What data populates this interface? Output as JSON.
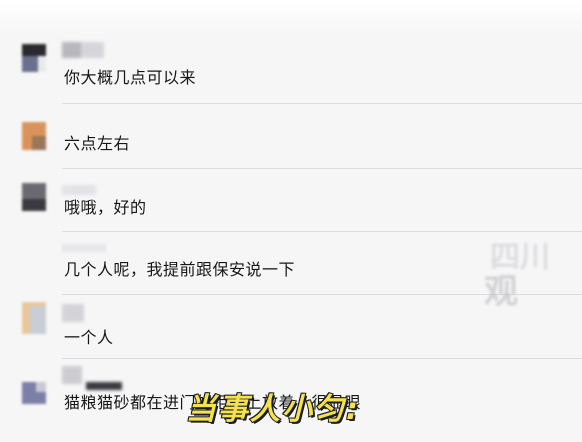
{
  "chat": {
    "messages": [
      {
        "text": "你大概几点可以来",
        "avatar": "avatar-grey"
      },
      {
        "text": "六点左右",
        "avatar": "avatar-orange"
      },
      {
        "text": "哦哦，好的",
        "avatar": "avatar-dark"
      },
      {
        "text": "几个人呢，我提前跟保安说一下",
        "avatar": "none"
      },
      {
        "text": "一个人",
        "avatar": "avatar-beige"
      },
      {
        "text": "猫粮猫砂都在进门的柜子上放着，很显眼",
        "avatar": "avatar-purple"
      }
    ]
  },
  "overlay": {
    "caption": "当事人小匀:",
    "watermark_top": "四川",
    "watermark_bottom": "观"
  },
  "colors": {
    "background": "#f6f6f7",
    "divider": "#dcdcde",
    "caption_fill": "#f3e24c",
    "caption_stroke": "#1b1b1b"
  }
}
